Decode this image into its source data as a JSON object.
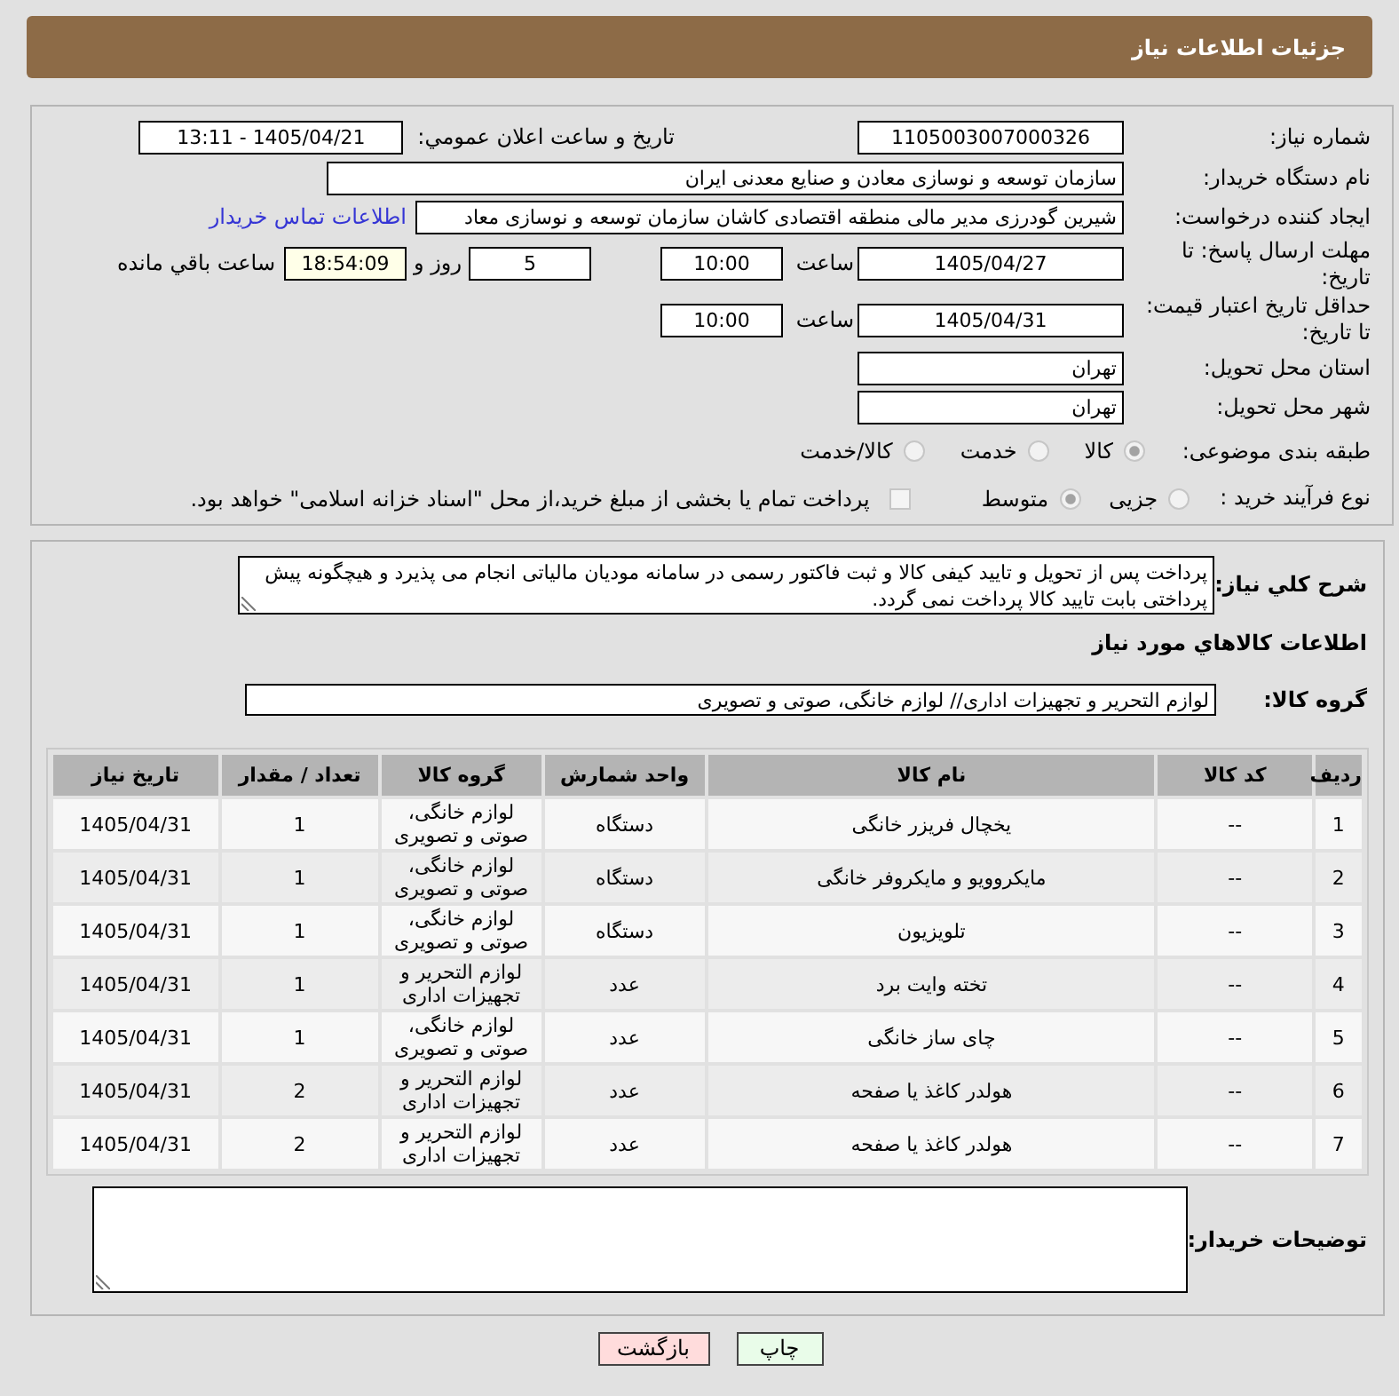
{
  "header": {
    "title": "جزئیات اطلاعات نیاز"
  },
  "form": {
    "need_number": {
      "label": "شماره نیاز:",
      "value": "1105003007000326"
    },
    "announce_datetime": {
      "label": "تاریخ و ساعت اعلان عمومي:",
      "value": "1405/04/21 - 13:11"
    },
    "buyer_org": {
      "label": "نام دستگاه خریدار:",
      "value": "سازمان توسعه و نوسازی معادن و صنایع معدنی ایران"
    },
    "requester": {
      "label": "ایجاد کننده درخواست:",
      "value": "شیرین گودرزی مدیر مالی منطقه اقتصادی کاشان سازمان توسعه و نوسازی معاد",
      "contact_link": "اطلاعات تماس خریدار"
    },
    "reply_deadline": {
      "label": "مهلت ارسال پاسخ: تا تاریخ:",
      "date": "1405/04/27",
      "time_label": "ساعت",
      "time": "10:00",
      "days": "5",
      "days_label": "روز و",
      "remaining": "18:54:09",
      "remaining_label": "ساعت باقي مانده"
    },
    "price_validity": {
      "label": "حداقل تاریخ اعتبار قیمت: تا تاریخ:",
      "date": "1405/04/31",
      "time_label": "ساعت",
      "time": "10:00"
    },
    "delivery_province": {
      "label": "استان محل تحویل:",
      "value": "تهران"
    },
    "delivery_city": {
      "label": "شهر محل تحویل:",
      "value": "تهران"
    },
    "subject_category": {
      "label": "طبقه بندی موضوعی:",
      "options": [
        {
          "label": "کالا",
          "selected": true,
          "disabled": true
        },
        {
          "label": "خدمت",
          "selected": false,
          "disabled": true
        },
        {
          "label": "کالا/خدمت",
          "selected": false,
          "disabled": true
        }
      ]
    },
    "purchase_process": {
      "label": "نوع فرآیند خرید :",
      "options": [
        {
          "label": "جزیی",
          "selected": false,
          "disabled": true
        },
        {
          "label": "متوسط",
          "selected": true,
          "disabled": true
        }
      ],
      "treasury_payment": {
        "label": "پرداخت تمام یا بخشی از مبلغ خرید،از محل \"اسناد خزانه اسلامی\" خواهد بود.",
        "checked": false,
        "disabled": true
      }
    }
  },
  "details": {
    "description": {
      "label": "شرح کلي نیاز:",
      "value": "پرداخت پس از تحویل و تایید کیفی کالا و ثبت فاکتور رسمی در سامانه مودیان مالیاتی انجام می پذیرد و هیچگونه پیش پرداختی بابت تایید کالا پرداخت نمی گردد."
    },
    "goods_heading": "اطلاعات کالاهاي مورد نیاز",
    "goods_group": {
      "label": "گروه کالا:",
      "value": "لوازم التحریر و تجهیزات اداری// لوازم خانگی، صوتی و تصویری"
    },
    "table": {
      "columns": [
        "ردیف",
        "کد کالا",
        "نام کالا",
        "واحد شمارش",
        "گروه کالا",
        "تعداد / مقدار",
        "تاریخ نیاز"
      ],
      "rows": [
        [
          "1",
          "--",
          "یخچال فریزر خانگی",
          "دستگاه",
          "لوازم خانگی، صوتی و تصویری",
          "1",
          "1405/04/31"
        ],
        [
          "2",
          "--",
          "مایکروویو و مایکروفر خانگی",
          "دستگاه",
          "لوازم خانگی، صوتی و تصویری",
          "1",
          "1405/04/31"
        ],
        [
          "3",
          "--",
          "تلویزیون",
          "دستگاه",
          "لوازم خانگی، صوتی و تصویری",
          "1",
          "1405/04/31"
        ],
        [
          "4",
          "--",
          "تخته وایت برد",
          "عدد",
          "لوازم التحریر و تجهیزات اداری",
          "1",
          "1405/04/31"
        ],
        [
          "5",
          "--",
          "چای ساز خانگی",
          "عدد",
          "لوازم خانگی، صوتی و تصویری",
          "1",
          "1405/04/31"
        ],
        [
          "6",
          "--",
          "هولدر کاغذ یا صفحه",
          "عدد",
          "لوازم التحریر و تجهیزات اداری",
          "2",
          "1405/04/31"
        ],
        [
          "7",
          "--",
          "هولدر کاغذ یا صفحه",
          "عدد",
          "لوازم التحریر و تجهیزات اداری",
          "2",
          "1405/04/31"
        ]
      ]
    },
    "buyer_notes": {
      "label": "توضیحات خریدار:"
    }
  },
  "buttons": [
    {
      "label": "چاپ",
      "kind": "print"
    },
    {
      "label": "بازگشت",
      "kind": "back"
    }
  ]
}
